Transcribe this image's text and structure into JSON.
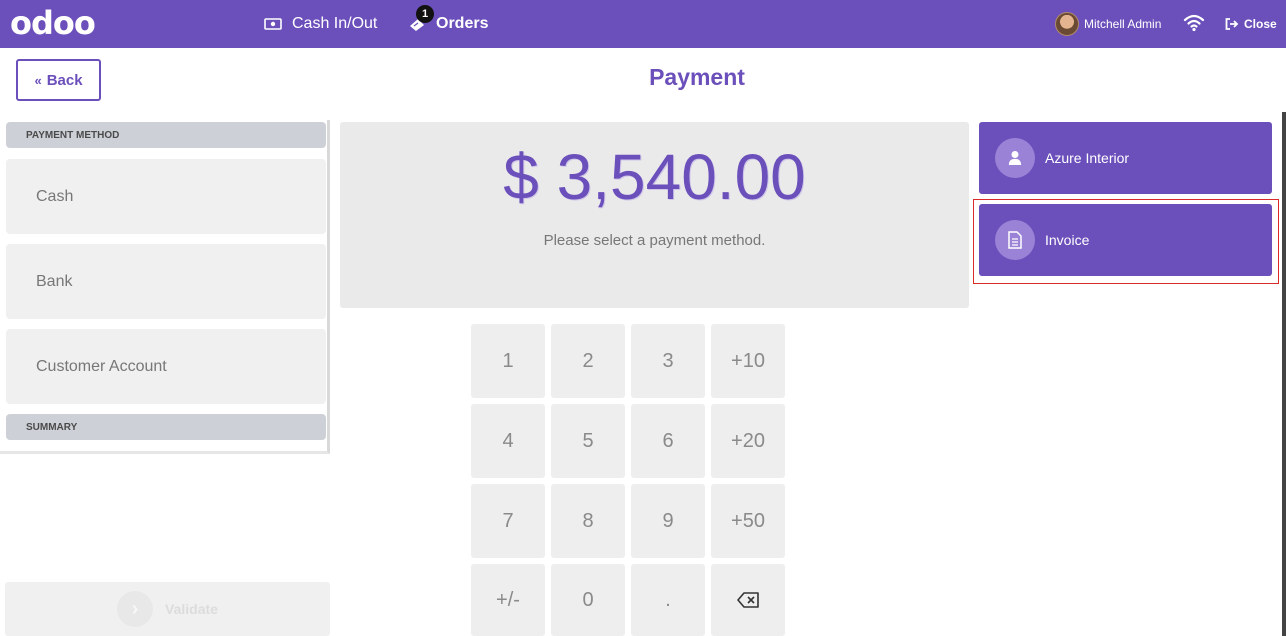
{
  "topbar": {
    "logo": "odoo",
    "cash_in_out": "Cash In/Out",
    "orders": "Orders",
    "orders_badge": "1",
    "user_name": "Mitchell Admin",
    "close": "Close"
  },
  "header": {
    "back": "Back",
    "title": "Payment"
  },
  "payment_methods": {
    "heading": "PAYMENT METHOD",
    "items": [
      "Cash",
      "Bank",
      "Customer Account"
    ],
    "summary_heading": "SUMMARY"
  },
  "amount": {
    "value": "$ 3,540.00",
    "message": "Please select a payment method."
  },
  "keypad": {
    "keys": [
      "1",
      "2",
      "3",
      "+10",
      "4",
      "5",
      "6",
      "+20",
      "7",
      "8",
      "9",
      "+50",
      "+/-",
      "0",
      "."
    ]
  },
  "actions": {
    "customer": "Azure Interior",
    "invoice": "Invoice",
    "validate": "Validate"
  },
  "colors": {
    "brand": "#6b4fbb",
    "highlight": "#d92a2a"
  }
}
